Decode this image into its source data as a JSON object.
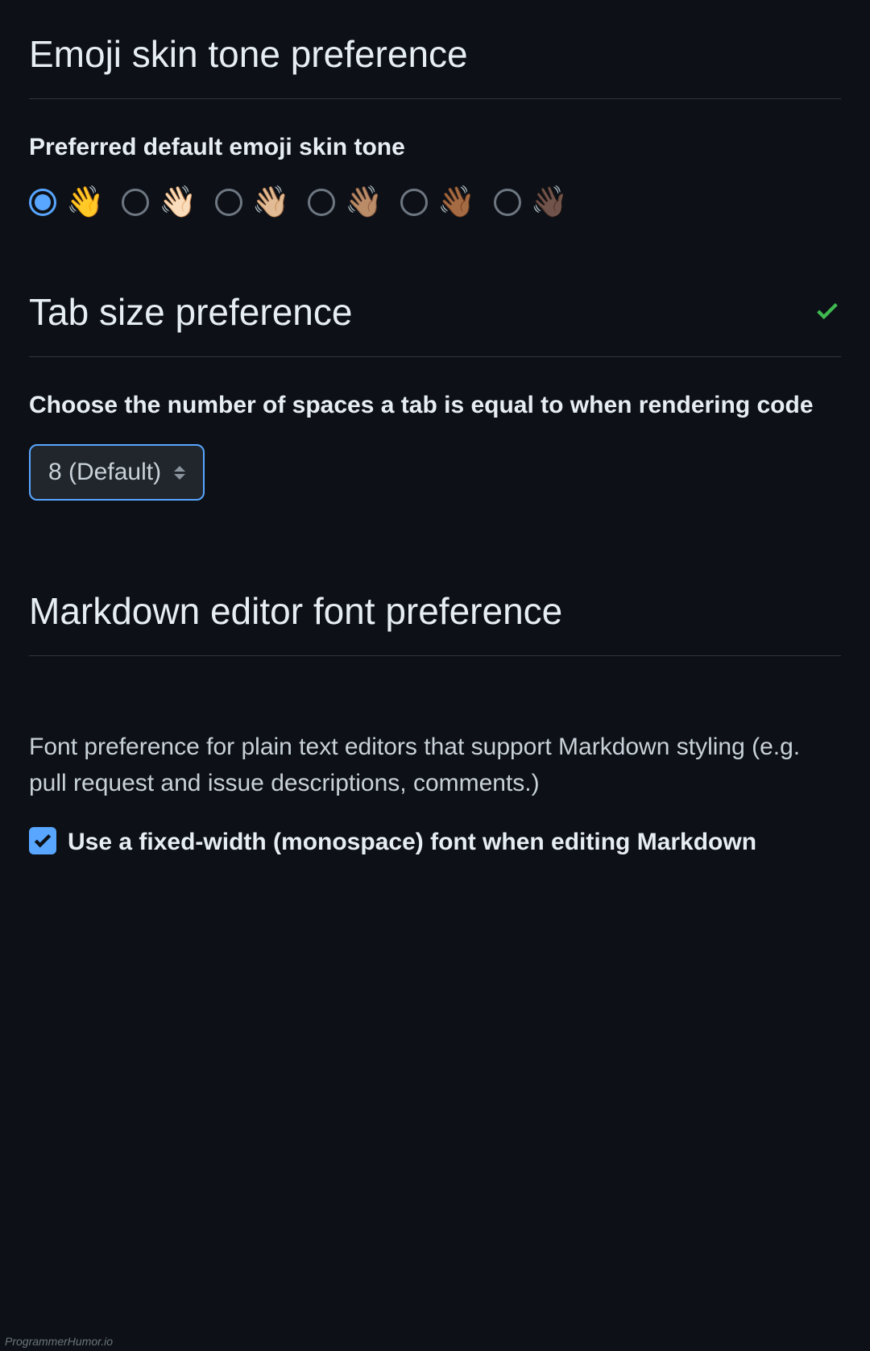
{
  "emoji_section": {
    "heading": "Emoji skin tone preference",
    "subheading": "Preferred default emoji skin tone",
    "options": [
      {
        "emoji": "👋",
        "selected": true
      },
      {
        "emoji": "👋🏻",
        "selected": false
      },
      {
        "emoji": "👋🏼",
        "selected": false
      },
      {
        "emoji": "👋🏽",
        "selected": false
      },
      {
        "emoji": "👋🏾",
        "selected": false
      },
      {
        "emoji": "👋🏿",
        "selected": false
      }
    ]
  },
  "tab_section": {
    "heading": "Tab size preference",
    "saved": true,
    "subheading": "Choose the number of spaces a tab is equal to when rendering code",
    "select_value": "8 (Default)"
  },
  "markdown_section": {
    "heading": "Markdown editor font preference",
    "body": "Font preference for plain text editors that support Markdown styling (e.g. pull request and issue descriptions, comments.)",
    "checkbox_label": "Use a fixed-width (monospace) font when editing Markdown",
    "checkbox_checked": true
  },
  "watermark": "ProgrammerHumor.io"
}
